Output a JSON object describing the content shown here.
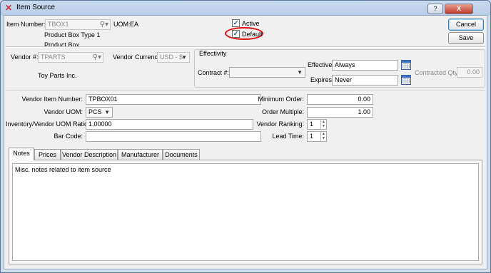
{
  "window": {
    "title": "Item Source"
  },
  "title_buttons": {
    "help": "?",
    "close": "X"
  },
  "item": {
    "number_label": "Item Number:",
    "number_value": "TBOX1",
    "uom_label": "UOM:",
    "uom_value": "EA",
    "desc1": "Product Box Type 1",
    "desc2": "Product Box"
  },
  "flags": {
    "active_label": "Active",
    "default_label": "Default"
  },
  "actions": {
    "cancel": "Cancel",
    "save": "Save"
  },
  "vendor": {
    "number_label": "Vendor #:",
    "number_value": "TPARTS",
    "currency_label": "Vendor Currency:",
    "currency_value": "USD - $",
    "name": "Toy Parts Inc."
  },
  "effectivity": {
    "title": "Effectivity",
    "contract_label": "Contract #:",
    "effective_label": "Effective",
    "effective_value": "Always",
    "expires_label": "Expires",
    "expires_value": "Never",
    "contracted_qty_label": "Contracted Qty:",
    "contracted_qty_value": "0.00"
  },
  "details": {
    "vendor_item_number_label": "Vendor Item Number:",
    "vendor_item_number_value": "TPBOX01",
    "vendor_uom_label": "Vendor UOM:",
    "vendor_uom_value": "PCS",
    "ratio_label": "Inventory/Vendor UOM Ratio:",
    "ratio_value": "1.00000",
    "barcode_label": "Bar Code:",
    "barcode_value": "",
    "min_order_label": "Minimum Order:",
    "min_order_value": "0.00",
    "order_multiple_label": "Order Multiple:",
    "order_multiple_value": "1.00",
    "vendor_ranking_label": "Vendor Ranking:",
    "vendor_ranking_value": "1",
    "lead_time_label": "Lead Time:",
    "lead_time_value": "1"
  },
  "tabs": [
    {
      "label": "Notes"
    },
    {
      "label": "Prices"
    },
    {
      "label": "Vendor Description"
    },
    {
      "label": "Manufacturer"
    },
    {
      "label": "Documents"
    }
  ],
  "notes_text": "Misc. notes related to item source",
  "colors": {
    "highlight_ring": "#e01010",
    "title_bar": "#c9daf0"
  }
}
